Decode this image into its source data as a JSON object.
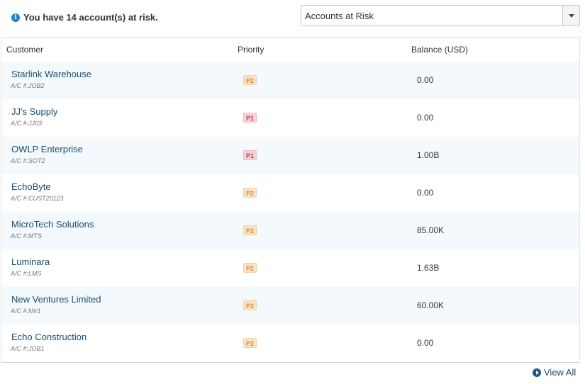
{
  "header": {
    "risk_message": "You have 14 account(s) at risk.",
    "info_icon": "info-icon",
    "info_glyph": "i"
  },
  "filter": {
    "selected": "Accounts at Risk"
  },
  "table": {
    "columns": {
      "customer": "Customer",
      "priority": "Priority",
      "balance": "Balance (USD)"
    },
    "rows": [
      {
        "name": "Starlink Warehouse",
        "account": "A/C #:JOB2",
        "priority": "P2",
        "balance": "0.00"
      },
      {
        "name": "JJ's Supply",
        "account": "A/C #:JJ03",
        "priority": "P1",
        "balance": "0.00"
      },
      {
        "name": "OWLP Enterprise",
        "account": "A/C #:SOT2",
        "priority": "P1",
        "balance": "1.00B"
      },
      {
        "name": "EchoByte",
        "account": "A/C #:CUST20123",
        "priority": "P2",
        "balance": "0.00"
      },
      {
        "name": "MicroTech Solutions",
        "account": "A/C #:MTS",
        "priority": "P2",
        "balance": "85.00K"
      },
      {
        "name": "Luminara",
        "account": "A/C #:LMS",
        "priority": "P2",
        "balance": "1.63B"
      },
      {
        "name": "New Ventures Limited",
        "account": "A/C #:NV1",
        "priority": "P2",
        "balance": "60.00K"
      },
      {
        "name": "Echo Construction",
        "account": "A/C #:JOB1",
        "priority": "P2",
        "balance": "0.00"
      }
    ]
  },
  "footer": {
    "view_all": "View All",
    "arrow_icon": "chevron-right-circle-icon"
  },
  "colors": {
    "accent": "#1a88c9",
    "link": "#1c4d6e",
    "row_alt": "#f3f9fd",
    "p1": "#f7d2d6",
    "p2": "#fbe3c6"
  }
}
